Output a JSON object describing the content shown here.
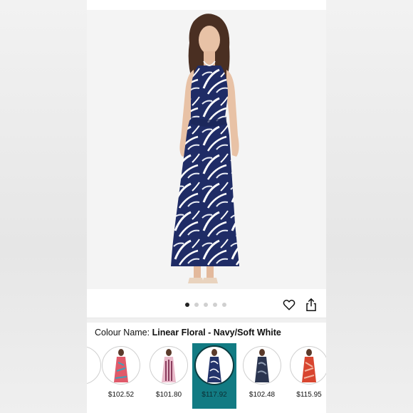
{
  "gallery": {
    "image_alt": "Woman wearing navy and white floral halter maxi dress",
    "dot_count": 5,
    "active_dot": 0
  },
  "actions": {
    "wishlist_icon": "heart-icon",
    "share_icon": "share-icon"
  },
  "colour": {
    "label": "Colour Name:",
    "value": "Linear Floral - Navy/Soft White"
  },
  "swatches": [
    {
      "price": "$102.52",
      "colors": [
        "#e05a6a",
        "#3fa0b8",
        "#f0d7a8"
      ],
      "selected": false
    },
    {
      "price": "$101.80",
      "colors": [
        "#c76a8e",
        "#e8b9c9",
        "#8a3d5e"
      ],
      "selected": false
    },
    {
      "price": "$117.92",
      "colors": [
        "#24346b",
        "#ffffff",
        "#1c2750"
      ],
      "selected": true
    },
    {
      "price": "$102.48",
      "colors": [
        "#2b3550",
        "#8e9ab0",
        "#1f273d"
      ],
      "selected": false
    },
    {
      "price": "$115.95",
      "colors": [
        "#d8452f",
        "#f2b49f",
        "#b8321f"
      ],
      "selected": false
    }
  ],
  "accent": "#127b83"
}
